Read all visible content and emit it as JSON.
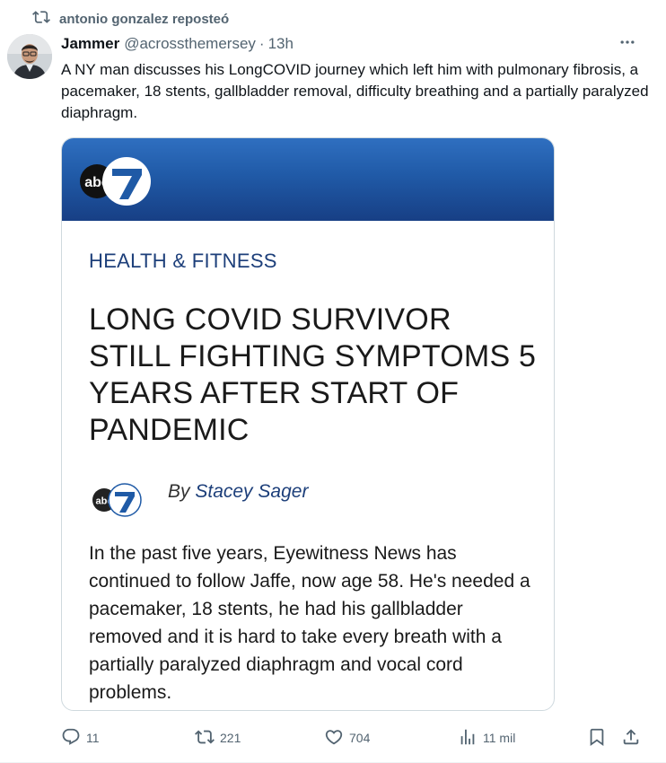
{
  "repost": {
    "text": "antonio gonzalez reposteó"
  },
  "tweet": {
    "author_name": "Jammer",
    "handle": "@acrossthemersey",
    "separator": "·",
    "time": "13h",
    "text": "A NY man discusses his LongCOVID journey which left him with pulmonary fibrosis, a pacemaker, 18 stents, gallbladder removal, difficulty breathing and a partially paralyzed diaphragm."
  },
  "card": {
    "category": "HEALTH & FITNESS",
    "headline": "LONG COVID SURVIVOR STILL FIGHTING SYMPTOMS 5 YEARS AFTER START OF PANDEMIC",
    "byline_prefix": "By",
    "byline_author": "Stacey Sager",
    "body": "In the past five years, Eyewitness News has continued to follow Jaffe, now age 58. He's needed a pacemaker, 18 stents, he had his gallbladder removed and it is hard to take every breath with a partially paralyzed diaphragm and vocal cord problems.",
    "logo_text": "abc",
    "logo_number": "7"
  },
  "actions": {
    "replies": "11",
    "reposts": "221",
    "likes": "704",
    "views": "11 mil"
  },
  "colors": {
    "muted": "#536471",
    "text": "#0f1419",
    "border": "#cfd9de",
    "banner": "#205aa7",
    "category": "#1d3f7a"
  }
}
